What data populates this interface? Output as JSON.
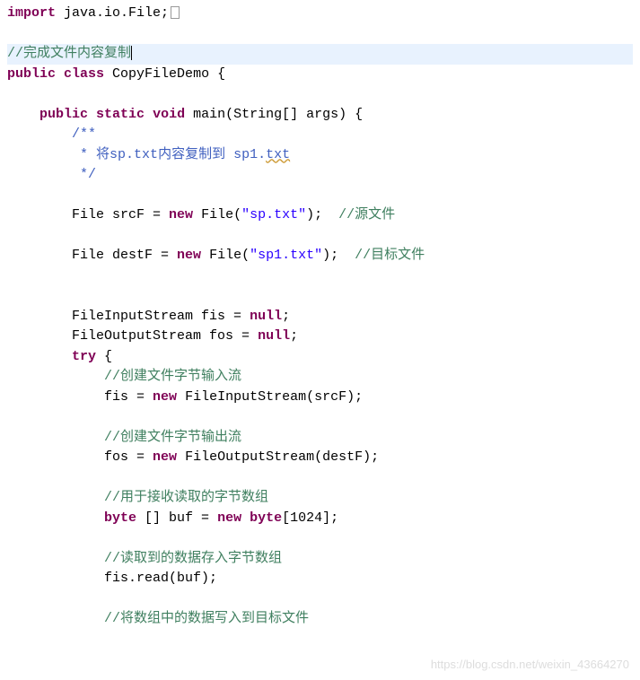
{
  "code": {
    "line1_kw1": "import",
    "line1_pkg": " java.io.File;",
    "line2_comment": "//完成文件内容复制",
    "line3_kw1": "public",
    "line3_kw2": "class",
    "line3_name": " CopyFileDemo {",
    "line5_kw1": "public",
    "line5_kw2": "static",
    "line5_kw3": "void",
    "line5_rest": " main(String[] args) {",
    "line6_jdoc": "/**",
    "line7_jdoc_prefix": " * ",
    "line7_jdoc_text1": "将",
    "line7_jdoc_code1": "sp.txt",
    "line7_jdoc_text2": "内容复制到 ",
    "line7_jdoc_code2a": "sp1.",
    "line7_jdoc_code2b": "txt",
    "line8_jdoc": " */",
    "line10_txt1": "File srcF = ",
    "line10_kw": "new",
    "line10_txt2": " File(",
    "line10_str": "\"sp.txt\"",
    "line10_txt3": ");  ",
    "line10_comment": "//源文件",
    "line12_txt1": "File destF = ",
    "line12_kw": "new",
    "line12_txt2": " File(",
    "line12_str": "\"sp1.txt\"",
    "line12_txt3": ");  ",
    "line12_comment": "//目标文件",
    "line15_txt1": "FileInputStream fis = ",
    "line15_kw": "null",
    "line15_txt2": ";",
    "line16_txt1": "FileOutputStream fos = ",
    "line16_kw": "null",
    "line16_txt2": ";",
    "line17_kw": "try",
    "line17_txt": " {",
    "line18_comment": "//创建文件字节输入流",
    "line19_txt1": "fis = ",
    "line19_kw": "new",
    "line19_txt2": " FileInputStream(srcF);",
    "line21_comment": "//创建文件字节输出流",
    "line22_txt1": "fos = ",
    "line22_kw": "new",
    "line22_txt2": " FileOutputStream(destF);",
    "line24_comment": "//用于接收读取的字节数组",
    "line25_kw1": "byte",
    "line25_txt1": " [] buf = ",
    "line25_kw2": "new",
    "line25_kw3": "byte",
    "line25_txt2": "[1024];",
    "line27_comment": "//读取到的数据存入字节数组",
    "line28_txt": "fis.read(buf);",
    "line30_comment": "//将数组中的数据写入到目标文件"
  },
  "watermark": "https://blog.csdn.net/weixin_43664270"
}
